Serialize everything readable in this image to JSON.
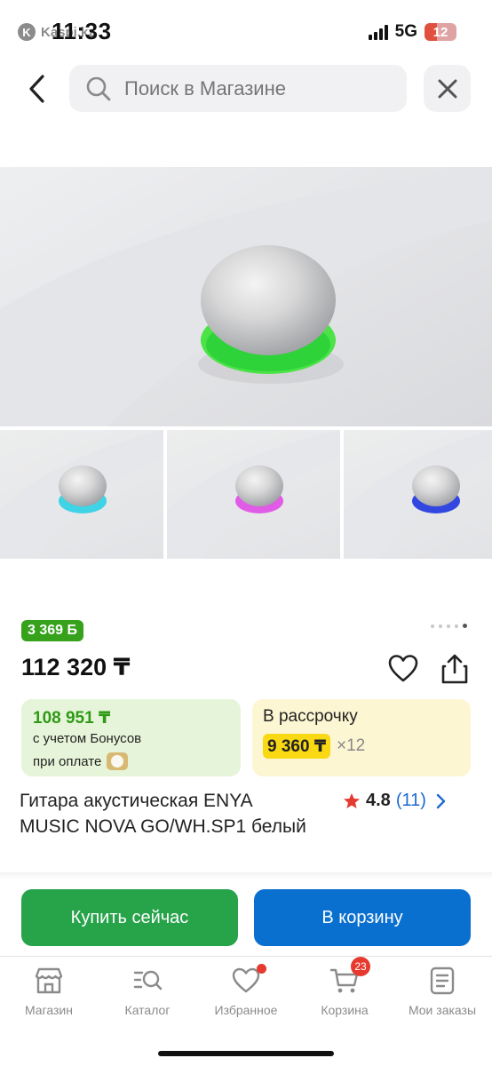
{
  "status_bar": {
    "app_label": "Kaspi.kz",
    "app_badge": "K",
    "time": "11:33",
    "network": "5G",
    "battery": "12"
  },
  "search": {
    "placeholder": "Поиск в Магазине"
  },
  "gallery": {
    "images": [
      {
        "name": "main",
        "ring_color": "#3fe04a"
      },
      {
        "name": "thumb-1",
        "ring_color": "#3fd3e6"
      },
      {
        "name": "thumb-2",
        "ring_color": "#e05ce6"
      },
      {
        "name": "thumb-3",
        "ring_color": "#3147e0"
      }
    ],
    "pages_total": 5,
    "current_page": 5
  },
  "product": {
    "bonus_badge": "3 369 Б",
    "price": "112 320 ₸",
    "title": "Гитара акустическая ENYA MUSIC NOVA GO/WH.SP1 белый",
    "rating": "4.8",
    "reviews": "(11)"
  },
  "bonus_card": {
    "amount": "108 951 ₸",
    "line1": "с учетом Бонусов",
    "line2": "при оплате"
  },
  "credit_card": {
    "title": "В рассрочку",
    "monthly": "9 360 ₸",
    "term": "×12"
  },
  "actions": {
    "buy_label": "Купить сейчас",
    "cart_label": "В корзину"
  },
  "tab_bar": {
    "shop": "Магазин",
    "catalog": "Каталог",
    "favorites": "Избранное",
    "cart": "Корзина",
    "cart_count": "23",
    "orders": "Мои заказы"
  },
  "colors": {
    "green": "#27a34a",
    "blue": "#0a70d0",
    "bonus_green": "#36a21c",
    "badge_red": "#e6392f",
    "credit_yellow": "#f9d913",
    "link_blue": "#1e6ad1"
  }
}
